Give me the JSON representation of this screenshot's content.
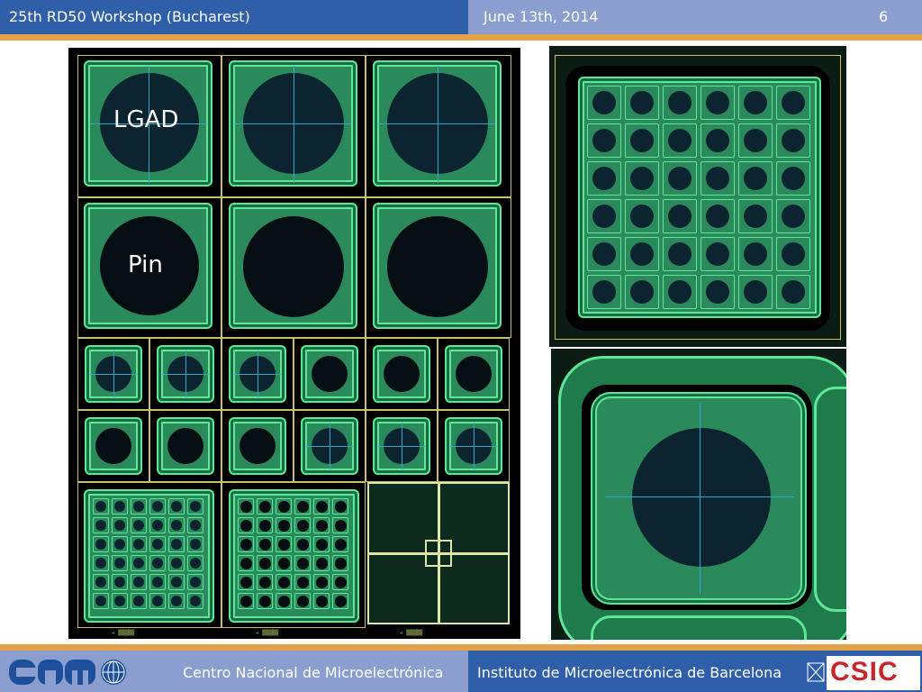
{
  "header": {
    "workshop": "25th RD50 Workshop (Bucharest)",
    "date": "June 13th, 2014",
    "slide_number": "6"
  },
  "left_panel": {
    "label_lgad": "LGAD",
    "label_pin": "Pin",
    "bottom_codes": [
      "→ ▒▒▒▒▒",
      "→ ▒▒▒▒▒",
      "→ ▒▒▒▒▒"
    ]
  },
  "footer": {
    "logo_left": "cnm",
    "center_text": "Centro Nacional de Microelectrónica",
    "institute_text": "Instituto de Microelectrónica de Barcelona",
    "logo_right": "CSIC",
    "colors": {
      "csic_red": "#c8262c",
      "header_blue": "#2e5fa8",
      "accent_orange": "#e3a14a"
    }
  }
}
